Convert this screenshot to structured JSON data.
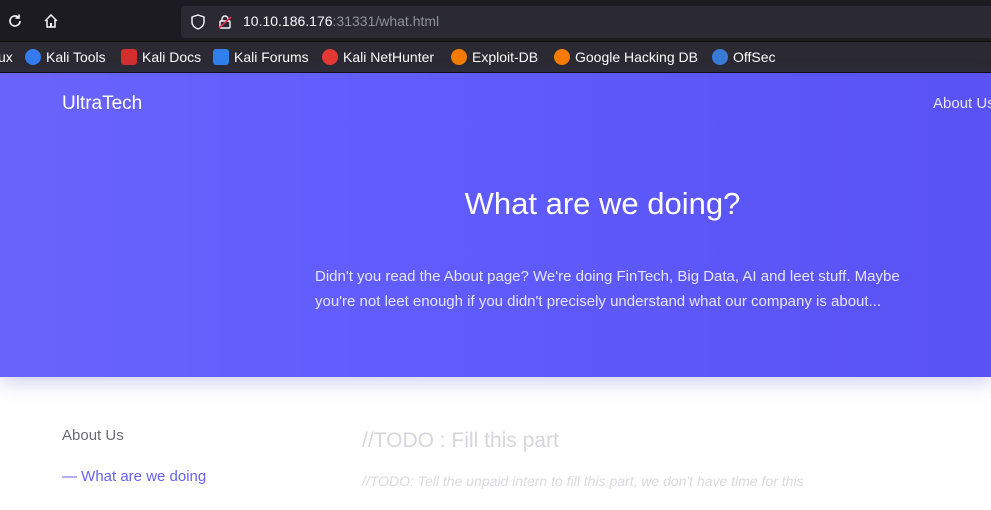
{
  "browser": {
    "url_host": "10.10.186.176",
    "url_rest": ":31331/what.html",
    "bookmarks": [
      {
        "label": "ux",
        "icon": "kali-icon",
        "color": "#367bf0"
      },
      {
        "label": "Kali Tools",
        "icon": "kali-tools-icon",
        "color": "#367bf0"
      },
      {
        "label": "Kali Docs",
        "icon": "kali-docs-icon",
        "color": "#d32f2f"
      },
      {
        "label": "Kali Forums",
        "icon": "kali-forums-icon",
        "color": "#2f80ed"
      },
      {
        "label": "Kali NetHunter",
        "icon": "nethunter-icon",
        "color": "#e53935"
      },
      {
        "label": "Exploit-DB",
        "icon": "exploitdb-icon",
        "color": "#f57c00"
      },
      {
        "label": "Google Hacking DB",
        "icon": "ghdb-icon",
        "color": "#f57c00"
      },
      {
        "label": "OffSec",
        "icon": "offsec-icon",
        "color": "#3a7bd5"
      }
    ]
  },
  "site": {
    "brand": "UltraTech",
    "nav_about": "About Us",
    "hero_title": "What are we doing?",
    "hero_text": "Didn't you read the About page? We're doing FinTech, Big Data, AI and leet stuff. Maybe you're not leet enough if you didn't precisely understand what our company is about...",
    "sidebar": {
      "item1": "About Us",
      "item2": "— What are we doing"
    },
    "todo_title": "//TODO : Fill this part",
    "todo_text": "//TODO: Tell the unpaid intern to fill this part, we don't have time for this"
  },
  "colors": {
    "hero_start": "#6a63fb",
    "hero_end": "#5a52f3",
    "accent": "#6563f2"
  }
}
